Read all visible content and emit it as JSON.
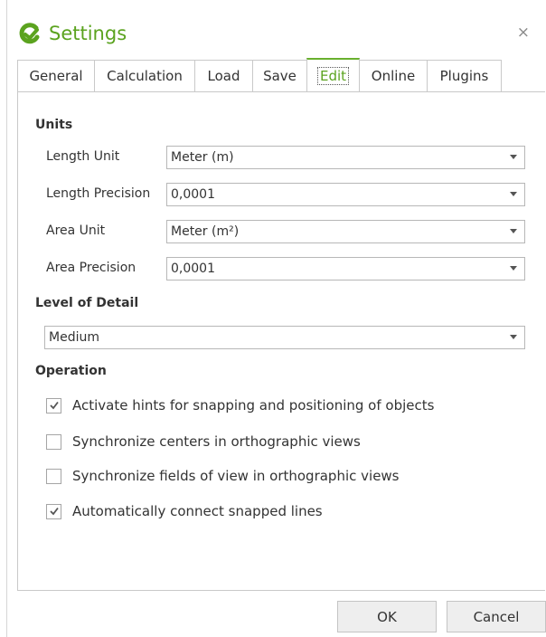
{
  "dialog": {
    "title": "Settings",
    "close_glyph": "×"
  },
  "tabs": [
    {
      "label": "General"
    },
    {
      "label": "Calculation"
    },
    {
      "label": "Load"
    },
    {
      "label": "Save"
    },
    {
      "label": "Edit",
      "active": true
    },
    {
      "label": "Online"
    },
    {
      "label": "Plugins"
    }
  ],
  "units": {
    "heading": "Units",
    "length_unit": {
      "label": "Length Unit",
      "value": "Meter (m)"
    },
    "length_precision": {
      "label": "Length Precision",
      "value": "0,0001"
    },
    "area_unit": {
      "label": "Area Unit",
      "value": "Meter (m²)"
    },
    "area_precision": {
      "label": "Area Precision",
      "value": "0,0001"
    }
  },
  "detail": {
    "heading": "Level of Detail",
    "value": "Medium"
  },
  "operation": {
    "heading": "Operation",
    "options": [
      {
        "label": "Activate hints for snapping and positioning of objects",
        "checked": true
      },
      {
        "label": "Synchronize centers in orthographic views",
        "checked": false
      },
      {
        "label": "Synchronize fields of view in orthographic views",
        "checked": false
      },
      {
        "label": "Automatically connect snapped lines",
        "checked": true
      }
    ]
  },
  "buttons": {
    "ok": "OK",
    "cancel": "Cancel"
  },
  "colors": {
    "accent": "#5ba31f",
    "border": "#c9c9c9"
  },
  "icons": {
    "logo": "app-logo-icon",
    "close": "close-icon",
    "dropdown": "chevron-down-icon",
    "check": "check-icon"
  }
}
